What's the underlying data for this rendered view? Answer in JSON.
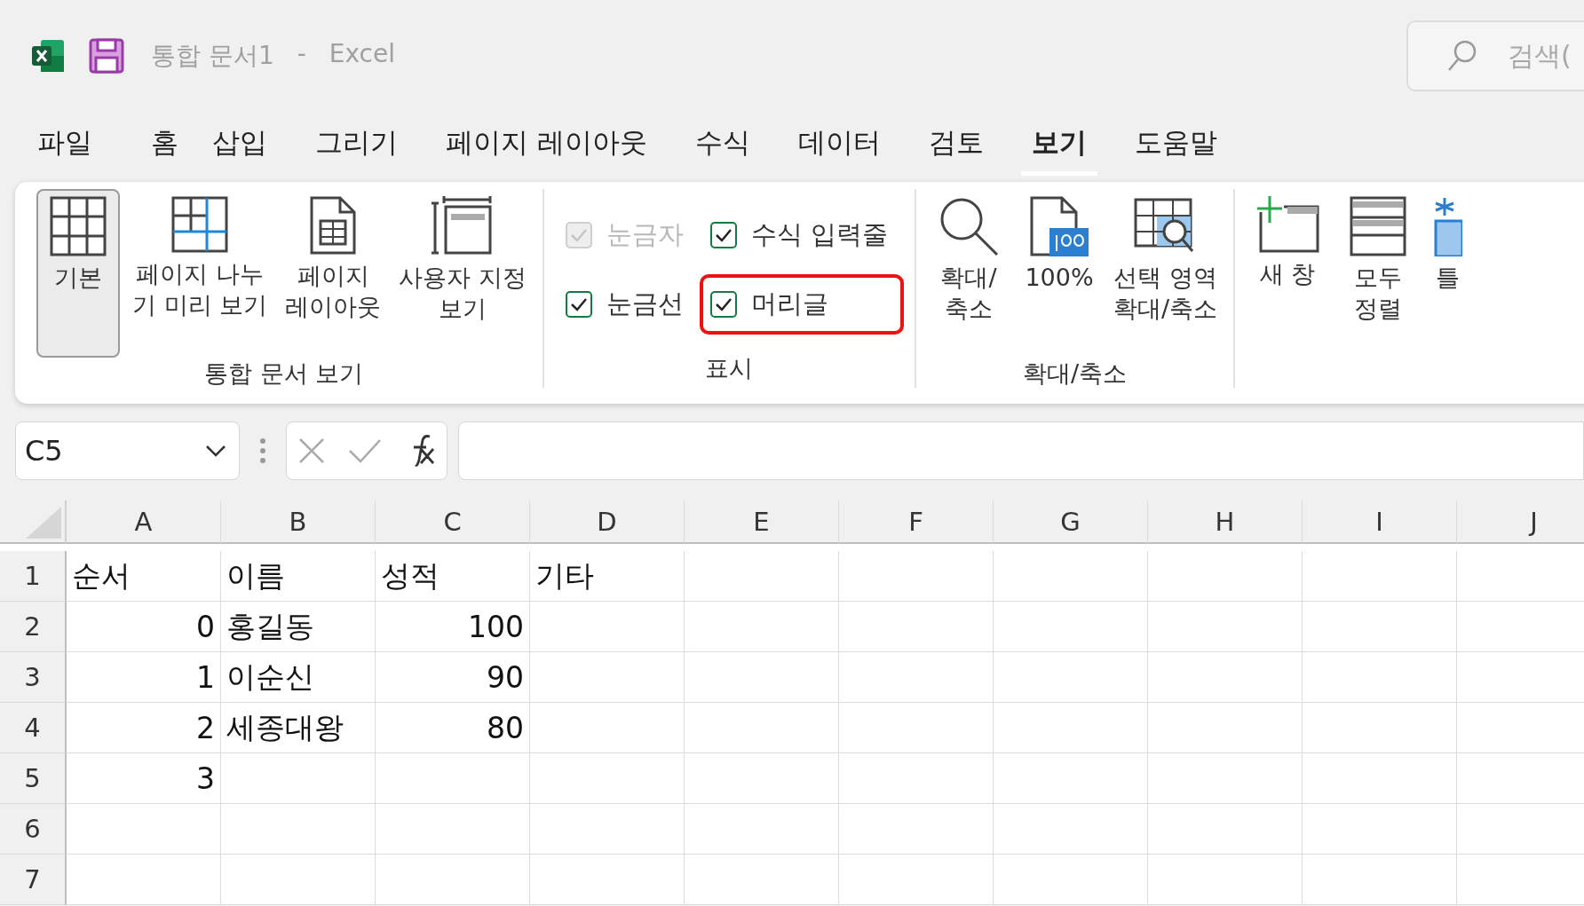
{
  "title_bar": {
    "document_title": "통합 문서1",
    "separator": "-",
    "app_name": "Excel",
    "search_placeholder": "검색("
  },
  "tabs": [
    {
      "label": "파일",
      "selected": false
    },
    {
      "label": "홈",
      "selected": false
    },
    {
      "label": "삽입",
      "selected": false
    },
    {
      "label": "그리기",
      "selected": false
    },
    {
      "label": "페이지 레이아웃",
      "selected": false
    },
    {
      "label": "수식",
      "selected": false
    },
    {
      "label": "데이터",
      "selected": false
    },
    {
      "label": "검토",
      "selected": false
    },
    {
      "label": "보기",
      "selected": true
    },
    {
      "label": "도움말",
      "selected": false
    }
  ],
  "ribbon": {
    "groups": [
      {
        "kind": "buttons",
        "label": "통합 문서 보기",
        "buttons": [
          {
            "kind": "normal",
            "lines": [
              "기본"
            ],
            "selected": true
          },
          {
            "kind": "page-break",
            "lines": [
              "페이지 나누",
              "기 미리 보기"
            ],
            "selected": false
          },
          {
            "kind": "page-layout",
            "lines": [
              "페이지",
              "레이아웃"
            ],
            "selected": false
          },
          {
            "kind": "custom-view",
            "lines": [
              "사용자 지정",
              "보기"
            ],
            "selected": false
          }
        ]
      },
      {
        "kind": "checkboxes",
        "label": "표시",
        "checkboxes": [
          {
            "label": "눈금자",
            "checked": true,
            "disabled": true,
            "highlighted": false
          },
          {
            "label": "수식 입력줄",
            "checked": true,
            "disabled": false,
            "highlighted": false
          },
          {
            "label": "눈금선",
            "checked": true,
            "disabled": false,
            "highlighted": false
          },
          {
            "label": "머리글",
            "checked": true,
            "disabled": false,
            "highlighted": true
          }
        ]
      },
      {
        "kind": "buttons",
        "label": "확대/축소",
        "buttons": [
          {
            "kind": "zoom",
            "lines": [
              "확대/",
              "축소"
            ],
            "selected": false
          },
          {
            "kind": "zoom-100",
            "lines": [
              "100%"
            ],
            "selected": false
          },
          {
            "kind": "zoom-selection",
            "lines": [
              "선택 영역",
              "확대/축소"
            ],
            "selected": false
          }
        ]
      },
      {
        "kind": "buttons",
        "buttons": [
          {
            "kind": "new-window",
            "lines": [
              "새 창"
            ],
            "selected": false
          },
          {
            "kind": "arrange-all",
            "lines": [
              "모두",
              "정렬"
            ],
            "selected": false
          },
          {
            "kind": "freeze",
            "lines": [
              "틀"
            ],
            "selected": false
          }
        ]
      }
    ]
  },
  "formula_bar": {
    "name_box": "C5"
  },
  "sheet": {
    "columns": [
      "A",
      "B",
      "C",
      "D",
      "E",
      "F",
      "G",
      "H",
      "I",
      "J"
    ],
    "rows": [
      {
        "header": "1",
        "cells": [
          {
            "text": "순서",
            "kind": "text"
          },
          {
            "text": "이름",
            "kind": "text"
          },
          {
            "text": "성적",
            "kind": "text"
          },
          {
            "text": "기타",
            "kind": "text"
          }
        ]
      },
      {
        "header": "2",
        "cells": [
          {
            "text": "0",
            "kind": "number"
          },
          {
            "text": "홍길동",
            "kind": "text"
          },
          {
            "text": "100",
            "kind": "number"
          }
        ]
      },
      {
        "header": "3",
        "cells": [
          {
            "text": "1",
            "kind": "number"
          },
          {
            "text": "이순신",
            "kind": "text"
          },
          {
            "text": "90",
            "kind": "number"
          }
        ]
      },
      {
        "header": "4",
        "cells": [
          {
            "text": "2",
            "kind": "number"
          },
          {
            "text": "세종대왕",
            "kind": "text"
          },
          {
            "text": "80",
            "kind": "number"
          }
        ]
      },
      {
        "header": "5",
        "cells": [
          {
            "text": "3",
            "kind": "number"
          }
        ]
      },
      {
        "header": "6"
      },
      {
        "header": "7"
      }
    ]
  }
}
